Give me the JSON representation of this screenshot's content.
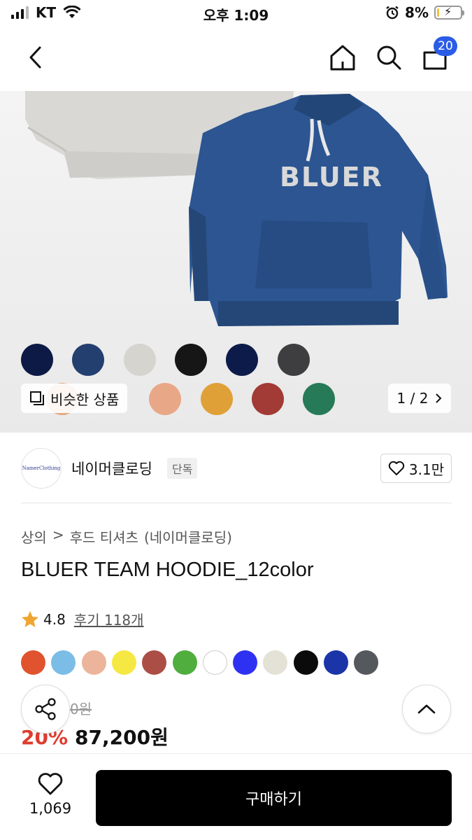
{
  "status_bar": {
    "carrier": "KT",
    "time": "오후 1:09",
    "battery": "8%",
    "battery_level": 0.08
  },
  "nav": {
    "cart_count": "20",
    "icons": [
      "back-icon",
      "home-icon",
      "search-icon",
      "cart-icon"
    ]
  },
  "hero": {
    "print_text": "BLUER",
    "swatches_top": [
      "#0c1a45",
      "#233f6f",
      "#d6d4cf",
      "#161616",
      "#0d1b4a",
      "#3e3e40"
    ],
    "swatches_bottom": [
      "#e3a882",
      "#e8a887",
      "#e0a038",
      "#a23a35",
      "#277a58"
    ],
    "similar_label": "비슷한 상품",
    "page_indicator": "1 / 2"
  },
  "brand": {
    "logo_text": "NamerClothing",
    "name": "네이머클로딩",
    "tag": "단독",
    "likes": "3.1만"
  },
  "breadcrumb": [
    "상의",
    ">",
    "후드 티셔츠",
    "(네이머클로딩)"
  ],
  "product": {
    "title": "BLUER TEAM HOODIE_12color",
    "rating": "4.8",
    "review_label": "후기 118개",
    "colors": [
      "#e0532e",
      "#7bbde6",
      "#ecb49a",
      "#f6e843",
      "#ab4e45",
      "#4fae3e",
      "#ffffff",
      "#2f31f2",
      "#e4e2d6",
      "#0b0b0b",
      "#1b34a8",
      "#55585d"
    ],
    "original_price": "0원",
    "discount": "20%",
    "price": "87,200원"
  },
  "bottom_bar": {
    "wish_count": "1,069",
    "buy_label": "구매하기"
  }
}
